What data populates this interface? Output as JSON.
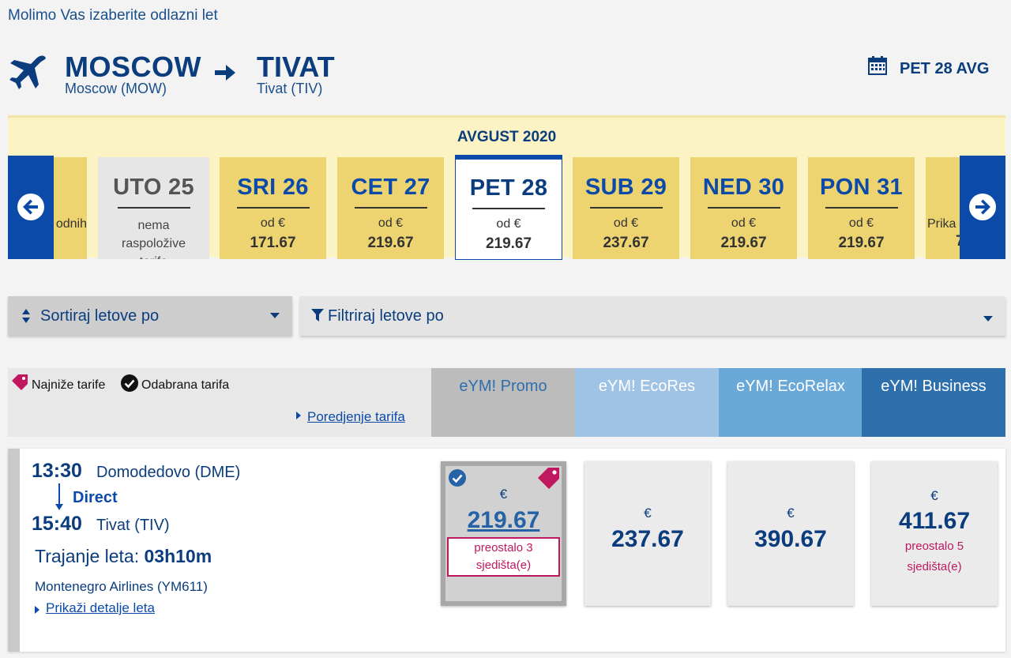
{
  "page": {
    "instruction": "Molimo Vas izaberite odlazni let"
  },
  "route": {
    "origin_code": "MOSCOW",
    "origin_sub": "Moscow (MOW)",
    "dest_code": "TIVAT",
    "dest_sub": "Tivat (TIV)",
    "selected_date": "PET 28 AVG",
    "icons": {
      "plane": "plane-icon",
      "arrow": "arrow-right-icon",
      "calendar": "calendar-icon"
    }
  },
  "calendar": {
    "month": "AVGUST 2020",
    "days": [
      {
        "partial_text": "odnih"
      },
      {
        "name": "UTO 25",
        "na_text_1": "nema",
        "na_text_2": "raspoložive",
        "na_text_3": "tarife"
      },
      {
        "name": "SRI 26",
        "od": "od €",
        "price": "171.67"
      },
      {
        "name": "CET 27",
        "od": "od €",
        "price": "219.67"
      },
      {
        "name": "PET 28",
        "od": "od €",
        "price": "219.67"
      },
      {
        "name": "SUB 29",
        "od": "od €",
        "price": "237.67"
      },
      {
        "name": "NED 30",
        "od": "od €",
        "price": "219.67"
      },
      {
        "name": "PON 31",
        "od": "od €",
        "price": "219.67"
      },
      {
        "partial_text": "Prika",
        "partial_price": "7"
      }
    ]
  },
  "controls": {
    "sort_label": "Sortiraj letove po",
    "filter_label": "Filtriraj letove po"
  },
  "legend": {
    "lowest": "Najniže tarife",
    "selected": "Odabrana tarifa",
    "compare": "Poredjenje tarifa"
  },
  "fare_columns": [
    "eYM! Promo",
    "eYM! EcoRes",
    "eYM! EcoRelax",
    "eYM! Business"
  ],
  "flight": {
    "dep_time": "13:30",
    "dep_airport": "Domodedovo (DME)",
    "direct": "Direct",
    "arr_time": "15:40",
    "arr_airport": "Tivat (TIV)",
    "duration_label": "Trajanje leta:",
    "duration_value": "03h10m",
    "airline": "Montenegro Airlines (YM611)",
    "details_link": "Prikaži detalje leta",
    "fares": [
      {
        "currency": "€",
        "amount": "219.67",
        "seats_1": "preostalo 3",
        "seats_2": "sjedišta(e)"
      },
      {
        "currency": "€",
        "amount": "237.67"
      },
      {
        "currency": "€",
        "amount": "390.67"
      },
      {
        "currency": "€",
        "amount": "411.67",
        "seats_1": "preostalo 5",
        "seats_2": "sjedišta(e)"
      }
    ]
  },
  "colors": {
    "primary": "#0b4aa8",
    "accent_pink": "#c0185f",
    "strip_yellow": "#eed470"
  }
}
